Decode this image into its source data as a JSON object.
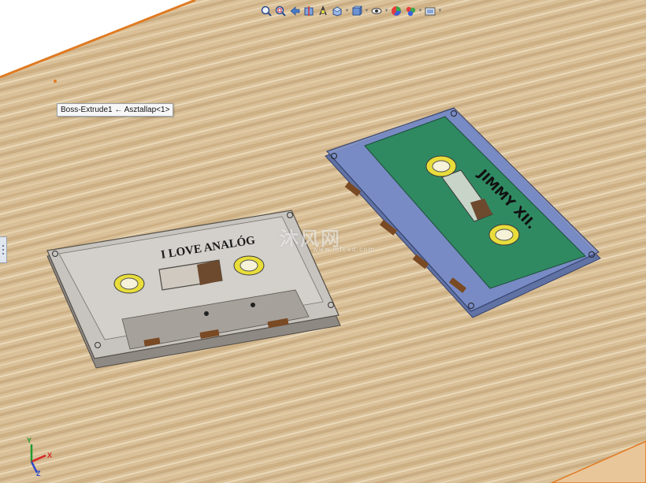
{
  "viewport": {
    "tooltip": "Boss-Extrude1 ← Asztallap<1>"
  },
  "toolbar": {
    "buttons": [
      {
        "name": "zoom-to-fit-icon"
      },
      {
        "name": "zoom-to-area-icon"
      },
      {
        "name": "previous-view-icon"
      },
      {
        "name": "section-view-icon"
      },
      {
        "name": "dynamic-annotation-icon"
      },
      {
        "name": "view-orientation-icon"
      },
      {
        "name": "display-style-icon"
      },
      {
        "name": "hide-show-items-icon"
      },
      {
        "name": "edit-appearance-icon"
      },
      {
        "name": "apply-scene-icon"
      },
      {
        "name": "view-settings-icon"
      }
    ]
  },
  "cassettes": {
    "left": {
      "label": "I LOVE ANALÓG"
    },
    "right": {
      "label": "JIMMY XII."
    }
  },
  "watermark": {
    "logo": "沐风网",
    "url": "www.mfcad.com"
  },
  "triad": {
    "x": "X",
    "y": "Y",
    "z": "Z"
  },
  "colors": {
    "table_wood": "#d9c098",
    "grain_dark": "#b9966a",
    "grain_light": "#ead7b6",
    "table_edge": "#e07a22",
    "left_shell": "#c7c3be",
    "right_shell": "#7b8ec8",
    "right_label": "#2f8a62",
    "reel_yellow": "#e8dd3a",
    "brown_pad": "#7a4a24"
  }
}
